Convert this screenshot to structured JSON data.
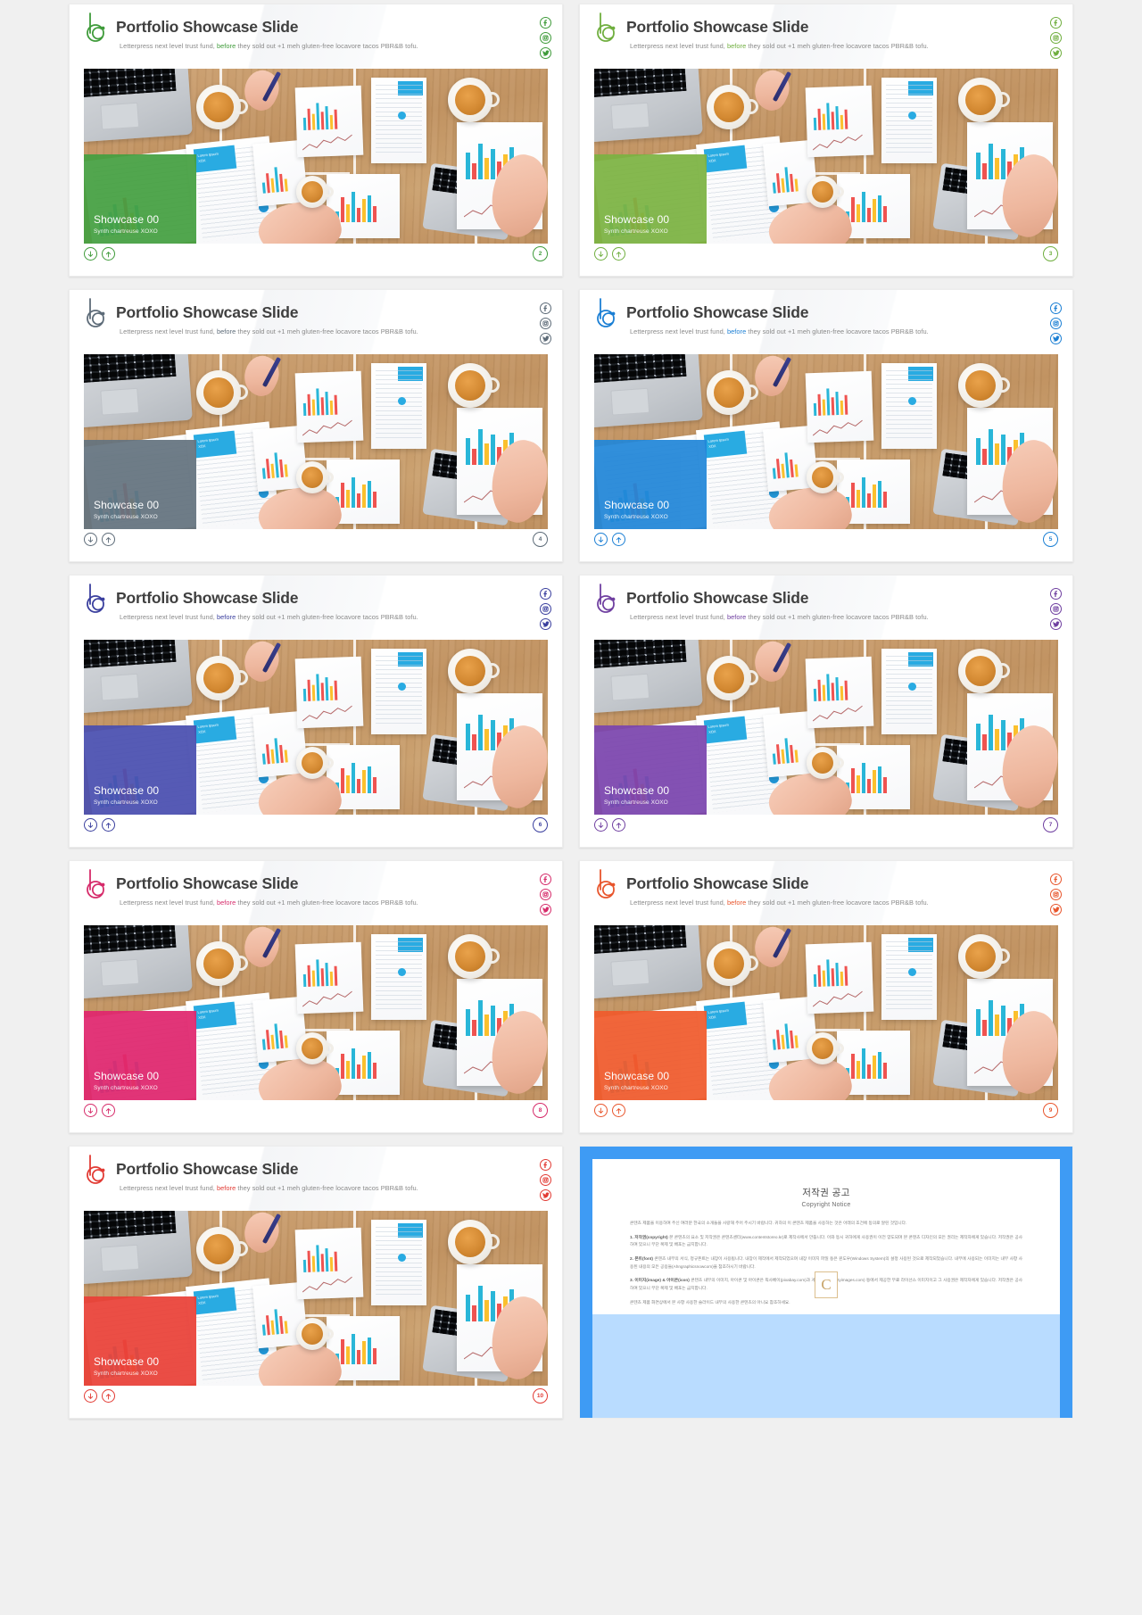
{
  "slide": {
    "title": "Portfolio Showcase Slide",
    "subtitle_a": "Letterpress next level trust fund, ",
    "subtitle_hl": "before",
    "subtitle_b": " they sold out +1 meh gluten-free locavore tacos PBR&B tofu.",
    "overlay_title": "Showcase 00",
    "overlay_sub": "Synth chartreuse XOXO",
    "logo_icon": "b-circle-logo-icon",
    "social_icons": [
      "facebook-icon",
      "instagram-icon",
      "twitter-icon"
    ],
    "nav_icons": [
      "arrow-down-icon",
      "arrow-up-icon"
    ]
  },
  "cards": [
    {
      "page": "2",
      "theme": "#3f9b3a",
      "accent": "#3f9b3a",
      "overlay": "#45a041"
    },
    {
      "page": "3",
      "theme": "#6fae3e",
      "accent": "#6fae3e",
      "overlay": "#7cb342"
    },
    {
      "page": "4",
      "theme": "#5d6b78",
      "accent": "#5d6b78",
      "overlay": "#64737f"
    },
    {
      "page": "5",
      "theme": "#1b7fd4",
      "accent": "#1b7fd4",
      "overlay": "#2186d8"
    },
    {
      "page": "6",
      "theme": "#3a3f9e",
      "accent": "#3a3f9e",
      "overlay": "#4a4fb0"
    },
    {
      "page": "7",
      "theme": "#6f3fa0",
      "accent": "#6f3fa0",
      "overlay": "#7b45ae"
    },
    {
      "page": "8",
      "theme": "#d62b6a",
      "accent": "#d62b6a",
      "overlay": "#e0266e"
    },
    {
      "page": "9",
      "theme": "#e8552c",
      "accent": "#e8552c",
      "overlay": "#f05a2c"
    },
    {
      "page": "10",
      "theme": "#e23b34",
      "accent": "#e23b34",
      "overlay": "#ea4138"
    }
  ],
  "copyright": {
    "title_ko": "저작권 공고",
    "title_en": "Copyright Notice",
    "intro": "콘텐츠 제품을 이용하여 주신 여러분 한국의 소개들을 사랑해 주어 주시기 바랍니다. 귀하의 이 콘텐츠 제품을 사용하는 것은 아래의 조건에 동의로 알린 것입니다.",
    "p1_label": "1. 저작권(copyright)",
    "p1": " 본 콘텐츠의 요소 및 저작권은 콘텐츠센터(www.contentstoreo.kr)로 제작사에서 만듭니다. 이와 동시 귀하에게 사용권이 이전 양도되며 본 콘텐츠 디자인의 모든 권리는 제작자에게 있습니다. 저작권은 공사하여 있으니 무단 복제 및 배포는 금지합니다.",
    "p2_label": "2. 폰트(font)",
    "p2": " 콘텐츠 내부의 서식, 정규폰트는 내장이 사용됩니다. 내장이 제작에서 제작되었으며 내장 이미지 파일 등은 윈도우(Windows System)의 설정 사용된 것으로 제작되었습니다. 내부에 사용되는 이미지는 내부 사항 사용된 내용의 모든 공용들(Ahngraphicsnowcom)을 참조하시기 바랍니다.",
    "p3_label": "3. 이미지(image) & 아이콘(icon)",
    "p3": " 콘텐츠 내부의 이미지, 아이콘 및 아이콘은 픽사베이(pixabay.com)과 게티이미지(gettyimages.com) 등에서 제공한 무료 라이선스 이미지이고 그 사용권은 제작자에게 있습니다. 저작권은 공사하여 있으니 무단 복제 및 배포는 금지합니다.",
    "closing": "콘텐츠 제품 화면상에서 본 사항 사용한 슬라이드 내부의 사용한 콘텐츠의 아니요 참조하세요."
  }
}
